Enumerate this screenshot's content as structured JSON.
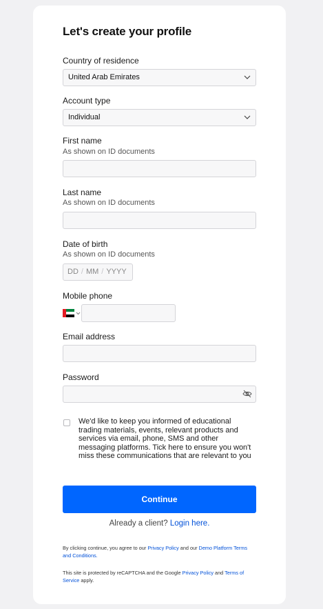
{
  "title": "Let's create your profile",
  "country": {
    "label": "Country of residence",
    "value": "United Arab Emirates"
  },
  "account_type": {
    "label": "Account type",
    "value": "Individual"
  },
  "first_name": {
    "label": "First name",
    "hint": "As shown on ID documents",
    "value": ""
  },
  "last_name": {
    "label": "Last name",
    "hint": "As shown on ID documents",
    "value": ""
  },
  "dob": {
    "label": "Date of birth",
    "hint": "As shown on ID documents",
    "dd": "DD",
    "mm": "MM",
    "yyyy": "YYYY",
    "sep": "/"
  },
  "phone": {
    "label": "Mobile phone",
    "flag_icon": "uae-flag-icon",
    "value": ""
  },
  "email": {
    "label": "Email address",
    "value": ""
  },
  "password": {
    "label": "Password",
    "value": "",
    "icon": "eye-off-icon"
  },
  "consent": {
    "text": "We'd like to keep you informed of educational trading materials, events, relevant products and services via email, phone, SMS and other messaging platforms. Tick here to ensure you won't miss these communications that are relevant to you",
    "checked": false
  },
  "continue_label": "Continue",
  "already": {
    "text": "Already a client?",
    "link": "Login here."
  },
  "terms": {
    "prefix": "By clicking continue, you agree to our",
    "privacy": "Privacy Policy",
    "and": "and our",
    "demo_terms": "Demo Platform Terms and Conditions."
  },
  "recaptcha": {
    "prefix": "This site is protected by reCAPTCHA and the Google",
    "privacy": "Privacy Policy",
    "and": "and",
    "terms": "Terms of Service",
    "suffix": "apply."
  },
  "colors": {
    "accent": "#0066ff",
    "link": "#0050d8",
    "background": "#f1f1f3"
  }
}
